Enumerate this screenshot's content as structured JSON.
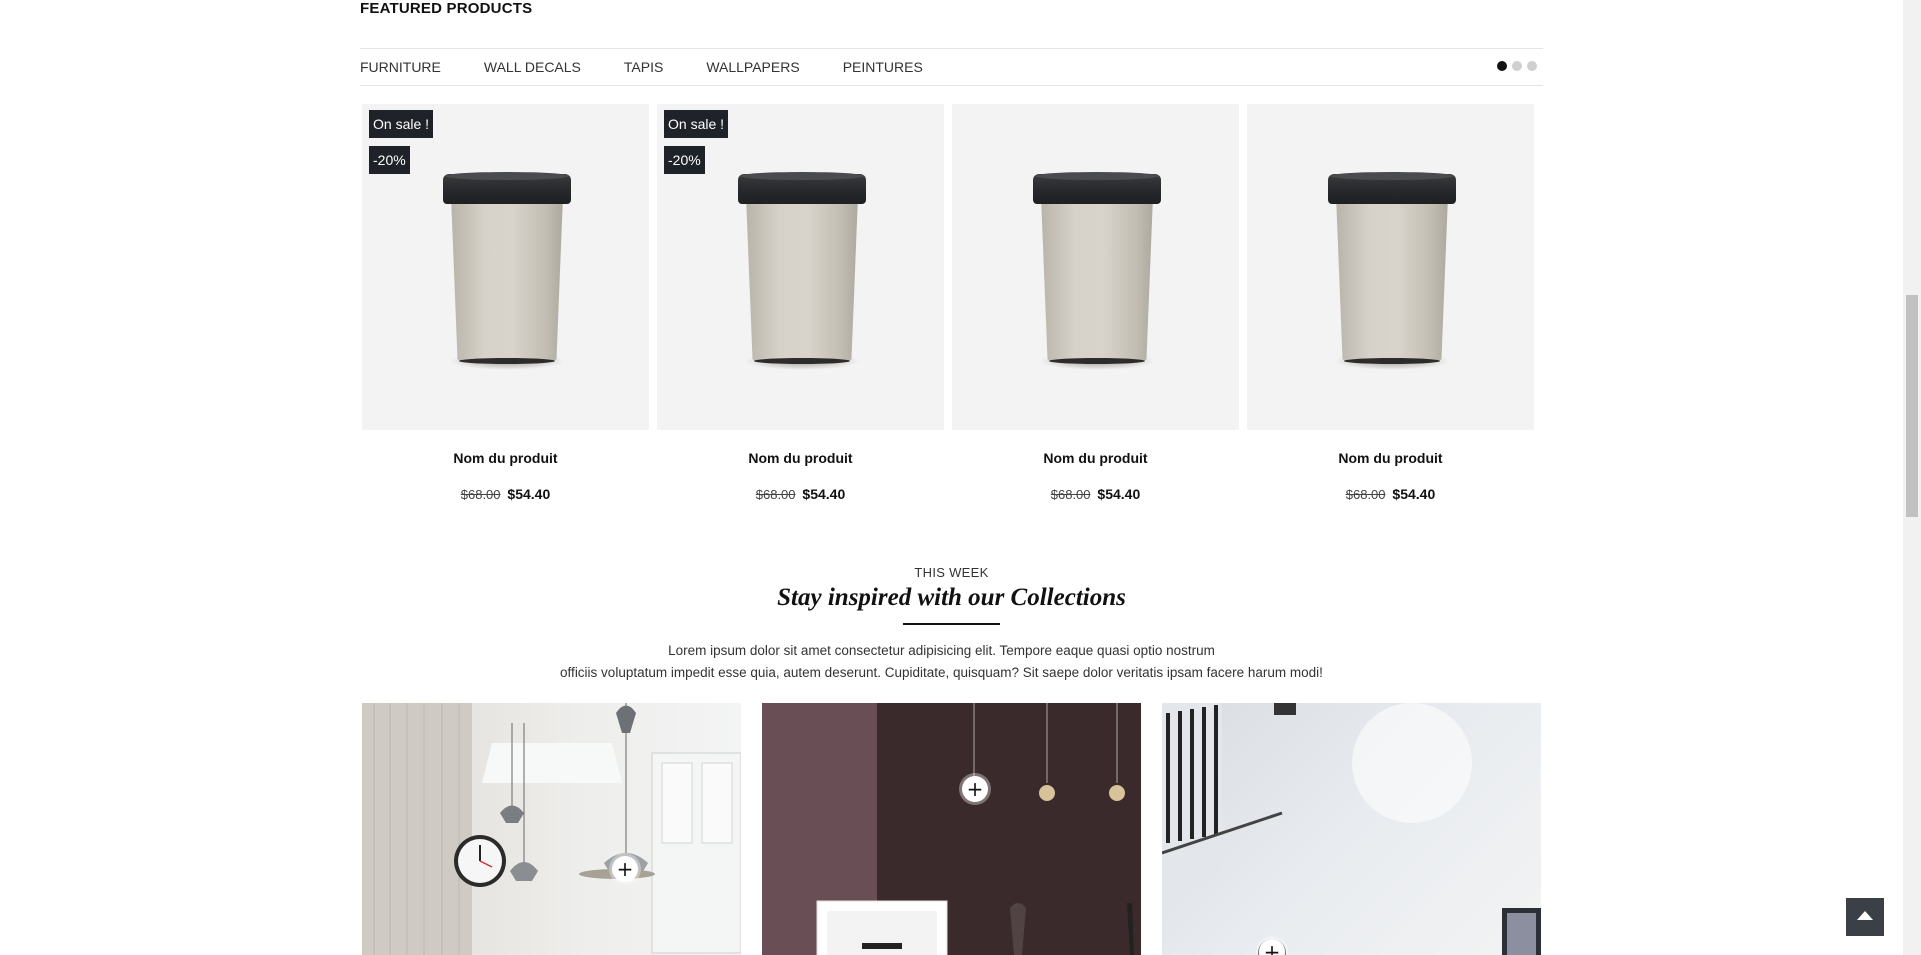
{
  "featured": {
    "title": "FEATURED PRODUCTS",
    "tabs": [
      "FURNITURE",
      "WALL DECALS",
      "TAPIS",
      "WALLPAPERS",
      "PEINTURES"
    ],
    "carousel_dots": 3,
    "active_dot": 0
  },
  "products": [
    {
      "name": "Nom du produit",
      "old_price": "$68.00",
      "price": "$54.40",
      "badge_sale": "On sale !",
      "badge_pct": "-20%"
    },
    {
      "name": "Nom du produit",
      "old_price": "$68.00",
      "price": "$54.40",
      "badge_sale": "On sale !",
      "badge_pct": "-20%"
    },
    {
      "name": "Nom du produit",
      "old_price": "$68.00",
      "price": "$54.40"
    },
    {
      "name": "Nom du produit",
      "old_price": "$68.00",
      "price": "$54.40"
    }
  ],
  "inspire": {
    "subtitle": "THIS WEEK",
    "title": "Stay inspired with our Collections",
    "desc_line1": "Lorem ipsum dolor sit amet consectetur adipisicing elit. Tempore eaque quasi optio nostrum",
    "desc_line2": "officiis voluptatum impedit esse quia, autem deserunt. Cupiditate, quisquam? Sit saepe dolor veritatis ipsam facere harum modi!"
  },
  "icons": {
    "plus": "+",
    "back_to_top": "chevron-up-icon"
  }
}
